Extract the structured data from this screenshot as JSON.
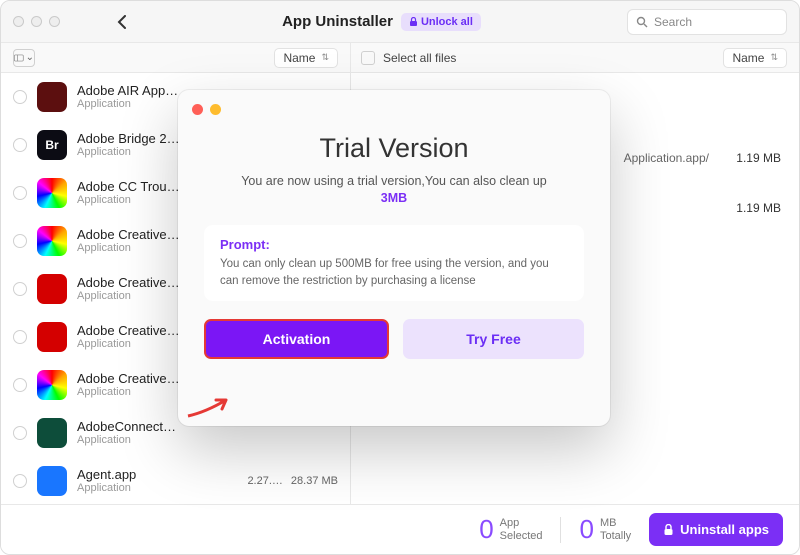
{
  "header": {
    "title": "App Uninstaller",
    "unlock_label": "Unlock all",
    "search_placeholder": "Search"
  },
  "columns": {
    "left_sort": "Name",
    "select_all": "Select all files",
    "right_sort": "Name"
  },
  "apps": [
    {
      "name": "Adobe AIR App…",
      "sub": "Application",
      "icon_bg": "#5c0f0f",
      "icon_txt": "",
      "ver": "",
      "size": ""
    },
    {
      "name": "Adobe Bridge 2…",
      "sub": "Application",
      "icon_bg": "#0c0c14",
      "icon_txt": "Br",
      "ver": "",
      "size": ""
    },
    {
      "name": "Adobe CC Trou…",
      "sub": "Application",
      "icon_bg": "rainbow",
      "icon_txt": "",
      "ver": "",
      "size": ""
    },
    {
      "name": "Adobe Creative…",
      "sub": "Application",
      "icon_bg": "rainbow",
      "icon_txt": "",
      "ver": "",
      "size": ""
    },
    {
      "name": "Adobe Creative…",
      "sub": "Application",
      "icon_bg": "#d40000",
      "icon_txt": "",
      "ver": "",
      "size": ""
    },
    {
      "name": "Adobe Creative…",
      "sub": "Application",
      "icon_bg": "#d40000",
      "icon_txt": "",
      "ver": "",
      "size": ""
    },
    {
      "name": "Adobe Creative…",
      "sub": "Application",
      "icon_bg": "rainbow",
      "icon_txt": "",
      "ver": "",
      "size": ""
    },
    {
      "name": "AdobeConnect…",
      "sub": "Application",
      "icon_bg": "#0d4d3a",
      "icon_txt": "",
      "ver": "",
      "size": ""
    },
    {
      "name": "Agent.app",
      "sub": "Application",
      "icon_bg": "#1976ff",
      "icon_txt": "",
      "ver": "2.27.…",
      "size": "28.37 MB"
    }
  ],
  "files": [
    {
      "path": "Application.app/",
      "size": "1.19 MB"
    },
    {
      "path": "",
      "size": "1.19 MB"
    }
  ],
  "footer": {
    "selected_count": "0",
    "selected_unit": "App",
    "selected_label": "Selected",
    "total_count": "0",
    "total_unit": "MB",
    "total_label": "Totally",
    "uninstall_label": "Uninstall apps"
  },
  "modal": {
    "title": "Trial Version",
    "sub_line": "You are now using a trial version,You can also clean up",
    "sub_highlight": "3MB",
    "prompt_title": "Prompt:",
    "prompt_body": "You can only clean up 500MB for free using the version, and you can remove the restriction by purchasing a license",
    "activation_label": "Activation",
    "tryfree_label": "Try Free"
  },
  "colors": {
    "accent": "#7b2ff5"
  }
}
